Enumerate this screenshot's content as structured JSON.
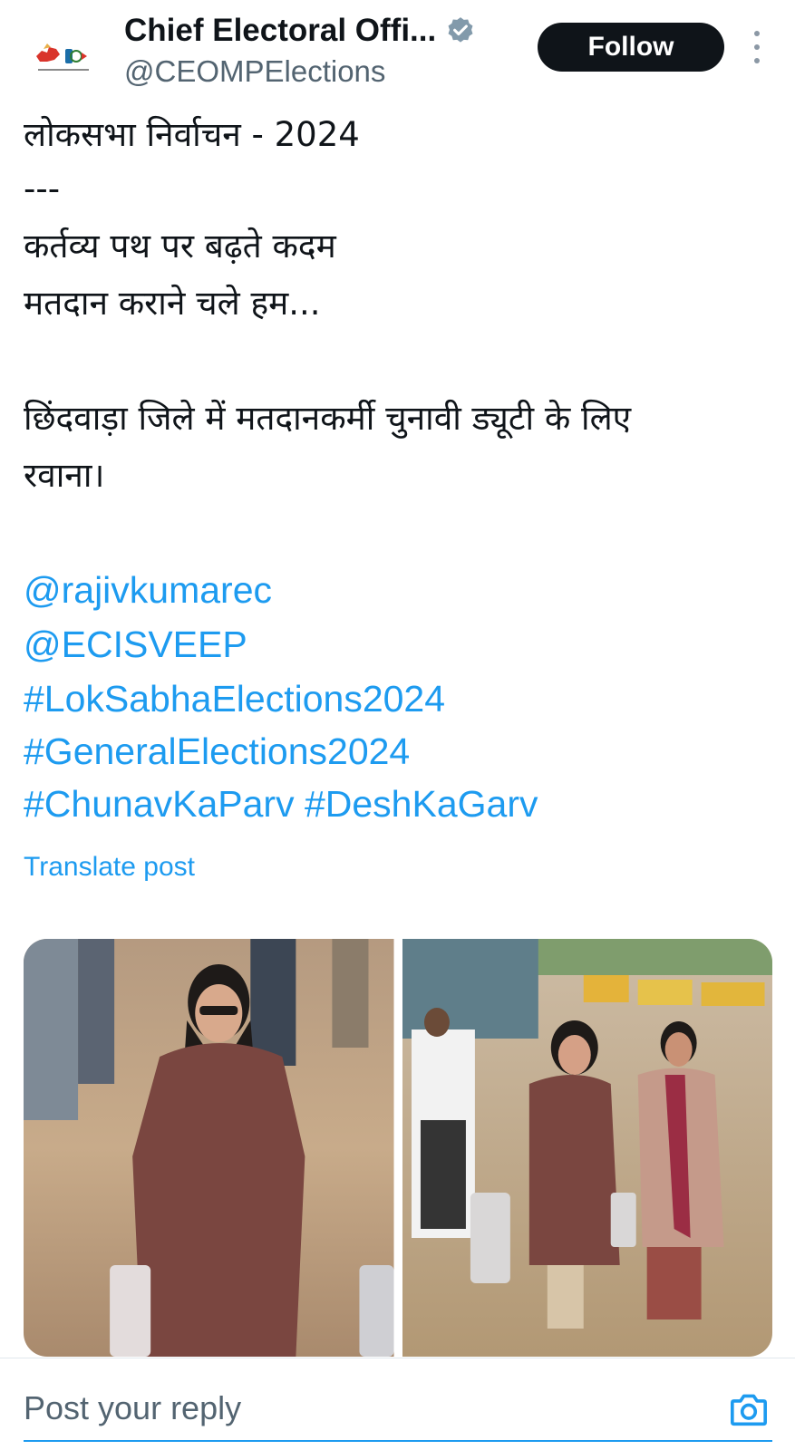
{
  "account": {
    "name": "Chief Electoral Offi...",
    "handle": "@CEOMPElections",
    "follow_label": "Follow"
  },
  "post": {
    "lines": [
      "लोकसभा निर्वाचन - 2024",
      "---",
      "कर्तव्य पथ पर बढ़ते कदम",
      "मतदान कराने चले हम...",
      "छिंदवाड़ा जिले में मतदानकर्मी चुनावी ड्यूटी के लिए",
      "रवाना।"
    ],
    "mentions": [
      "@rajivkumarec",
      "@ECISVEEP"
    ],
    "hashtags": [
      "#LokSabhaElections2024",
      "#GeneralElections2024",
      "#ChunavKaParv #DeshKaGarv"
    ],
    "translate_label": "Translate post"
  },
  "media": {
    "photo_count": 2
  },
  "reply": {
    "placeholder": "Post your reply"
  },
  "colors": {
    "link": "#1d9bf0",
    "follow_bg": "#0f1419",
    "secondary_text": "#536471"
  },
  "icons": [
    "verified-badge-icon",
    "more-options-icon",
    "camera-icon"
  ]
}
